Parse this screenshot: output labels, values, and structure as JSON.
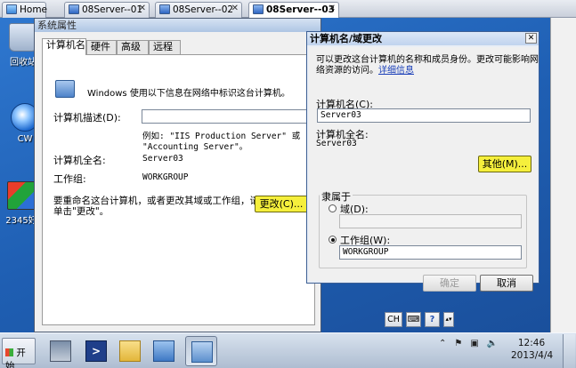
{
  "tabs": [
    {
      "label": "Home",
      "active": false
    },
    {
      "label": "08Server--01",
      "active": false
    },
    {
      "label": "08Server--02",
      "active": false
    },
    {
      "label": "08Server--03",
      "active": true
    }
  ],
  "desktop": {
    "icons": [
      {
        "label": "回收站",
        "icon": "recycle-bin-icon"
      },
      {
        "label": "CW",
        "icon": "cw-icon"
      },
      {
        "label": "2345好",
        "icon": "2345-icon"
      }
    ]
  },
  "sysprop": {
    "title": "系统属性",
    "tabs": [
      "计算机名",
      "硬件",
      "高级",
      "远程"
    ],
    "intro": "Windows 使用以下信息在网络中标识这台计算机。",
    "desc_label": "计算机描述(D):",
    "desc_value": "",
    "example_line1": "例如: \"IIS Production Server\" 或",
    "example_line2": "\"Accounting Server\"。",
    "fullname_label": "计算机全名:",
    "fullname_value": "Server03",
    "workgroup_label": "工作组:",
    "workgroup_value": "WORKGROUP",
    "rename_text_line1": "要重命名这台计算机，或者更改其域或工作组，请",
    "rename_text_line2": "单击\"更改\"。",
    "change_button": "更改(C)..."
  },
  "rename": {
    "title": "计算机名/域更改",
    "intro_line1": "可以更改这台计算机的名称和成员身份。更改可能影响网",
    "intro_line2": "络资源的访问。",
    "more_info": "详细信息",
    "name_label": "计算机名(C):",
    "name_value": "Server03",
    "fullname_label": "计算机全名:",
    "fullname_value": "Server03",
    "other_button": "其他(M)...",
    "member_of_label": "隶属于",
    "domain_label": "域(D):",
    "domain_value": "",
    "workgroup_label": "工作组(W):",
    "workgroup_value": "WORKGROUP",
    "selected": "workgroup",
    "ok_button": "确定",
    "cancel_button": "取消"
  },
  "remote_toolbar": {
    "lang": "CH"
  },
  "taskbar": {
    "start_label": "开始",
    "clock_time": "12:46",
    "clock_date": "2013/4/4"
  },
  "colors": {
    "highlight": "#f5ef3c",
    "desktop": "#2264ba",
    "link": "#1a3fb8"
  }
}
